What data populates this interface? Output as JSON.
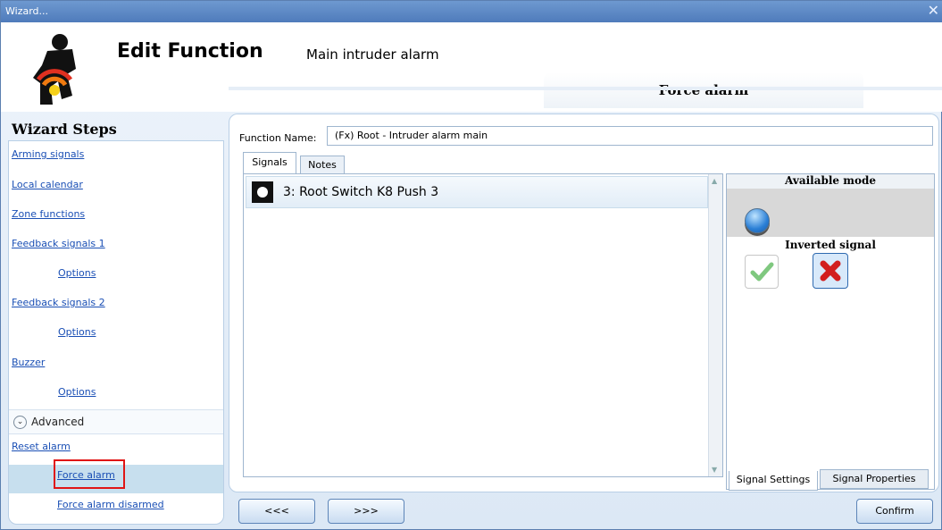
{
  "window": {
    "title": "Wizard...",
    "close_glyph": "✕"
  },
  "header": {
    "title": "Edit Function",
    "subtitle": "Main intruder alarm",
    "stage_tab": "Force alarm"
  },
  "wizard": {
    "heading": "Wizard Steps",
    "steps": [
      {
        "label": "Arming signals"
      },
      {
        "label": "Local calendar"
      },
      {
        "label": "Zone functions"
      },
      {
        "label": "Feedback signals 1"
      },
      {
        "label": "Options"
      },
      {
        "label": "Feedback signals 2"
      },
      {
        "label": "Options"
      },
      {
        "label": "Buzzer"
      },
      {
        "label": "Options"
      }
    ],
    "advanced": {
      "label": "Advanced",
      "icon": "chevron-down-icon",
      "glyph": "⌄"
    },
    "advanced_steps": [
      {
        "label": "Reset alarm"
      },
      {
        "label": "Force alarm",
        "active": true
      },
      {
        "label": "Force alarm disarmed"
      }
    ]
  },
  "form": {
    "function_name_label": "Function Name:",
    "function_name_value": "(Fx) Root - Intruder alarm main"
  },
  "tabs": {
    "signals": "Signals",
    "notes": "Notes"
  },
  "signals": [
    {
      "label": "3: Root Switch K8 Push 3",
      "icon": "switch-icon"
    }
  ],
  "right_panel": {
    "available_mode": "Available mode",
    "mode_icon": "pushbutton-icon",
    "inverted_signal": "Inverted signal",
    "tab_settings": "Signal Settings",
    "tab_properties": "Signal Properties"
  },
  "buttons": {
    "prev": "<<<",
    "next": ">>>",
    "confirm": "Confirm"
  },
  "colors": {
    "accent": "#1a4fb5",
    "highlight": "#e01515",
    "active_row": "#c7dfee"
  }
}
